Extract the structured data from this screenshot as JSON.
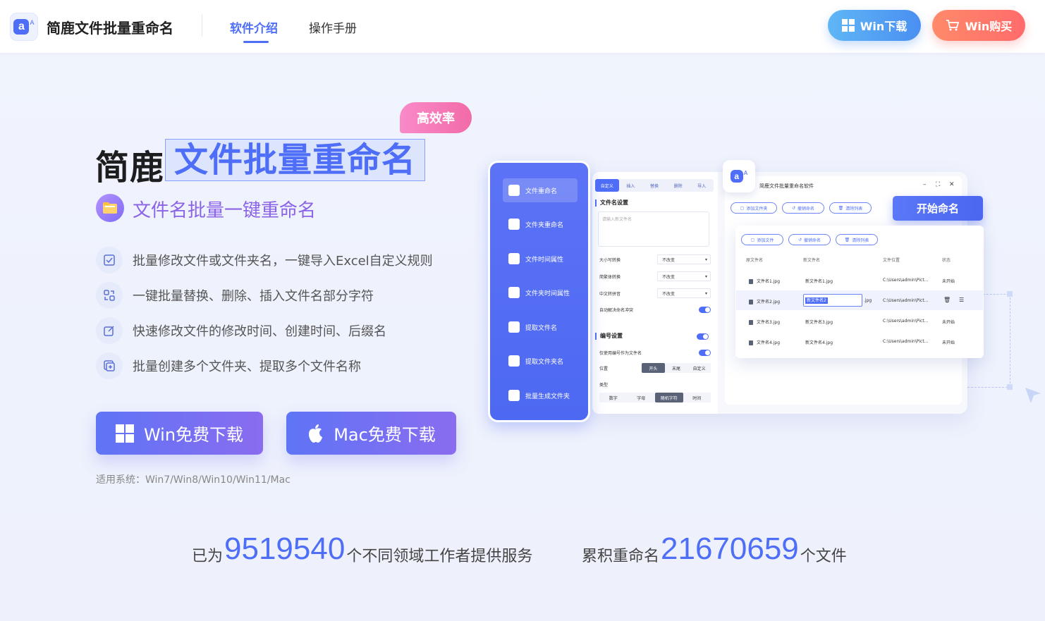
{
  "header": {
    "brand": "简鹿文件批量重命名",
    "nav": [
      "软件介绍",
      "操作手册"
    ],
    "win_download": "Win下载",
    "win_buy": "Win购买"
  },
  "hero": {
    "tag": "高效率",
    "title_pre": "简鹿",
    "title_main": "文件批量重命名",
    "subtitle": "文件名批量一键重命名",
    "features": [
      "批量修改文件或文件夹名，一键导入Excel自定义规则",
      "一键批量替换、删除、插入文件名部分字符",
      "快速修改文件的修改时间、创建时间、后缀名",
      "批量创建多个文件夹、提取多个文件名称"
    ],
    "win_free": "Win免费下载",
    "mac_free": "Mac免费下载",
    "os_note": "适用系统：Win7/Win8/Win10/Win11/Mac"
  },
  "stats": {
    "s1_pre": "已为",
    "s1_num": "9519540",
    "s1_post": "个不同领域工作者提供服务",
    "s2_pre": "累积重命名",
    "s2_num": "21670659",
    "s2_post": "个文件"
  },
  "mockup": {
    "sidebar": [
      "文件重命名",
      "文件夹重命名",
      "文件时间属性",
      "文件夹时间属性",
      "提取文件名",
      "提取文件夹名",
      "批量生成文件夹"
    ],
    "tabs": [
      "自定义",
      "插入",
      "替换",
      "删除",
      "导入"
    ],
    "section1": "文件名设置",
    "placeholder": "请输入新文件名",
    "rows": [
      {
        "label": "大小写转换",
        "value": "不改变"
      },
      {
        "label": "简繁体转换",
        "value": "不改变"
      },
      {
        "label": "中文转拼音",
        "value": "不改变"
      }
    ],
    "auto_conflict": "自动解决命名冲突",
    "section2": "编号设置",
    "only_number": "仅使用编号作为文件名",
    "position_label": "位置",
    "position_opts": [
      "开头",
      "末尾",
      "自定义"
    ],
    "type_label": "类型",
    "type_opts": [
      "数字",
      "字母",
      "随机字符",
      "时间"
    ],
    "app_title": "简鹿文件批量重命名软件",
    "top_btns": [
      "添加文件夹",
      "撤销命名",
      "清除列表"
    ],
    "start": "开始命名",
    "card_btns": [
      "添加文件",
      "撤销命名",
      "清除列表"
    ],
    "cols": [
      "原文件名",
      "新文件名",
      "文件位置",
      "状态"
    ],
    "files": [
      {
        "old": "文件名1.jpg",
        "new": "新文件名1.jpg",
        "path": "C:\\Users\\admin\\Pict...",
        "status": "未开始"
      },
      {
        "old": "文件名2.jpg",
        "new": "新文件名2",
        "ext": ".jpg",
        "path": "C:\\Users\\admin\\Pict...",
        "status": ""
      },
      {
        "old": "文件名3.jpg",
        "new": "新文件名3.jpg",
        "path": "C:\\Users\\admin\\Pict...",
        "status": "未开始"
      },
      {
        "old": "文件名4.jpg",
        "new": "新文件名4.jpg",
        "path": "C:\\Users\\admin\\Pict...",
        "status": "未开始"
      }
    ]
  }
}
